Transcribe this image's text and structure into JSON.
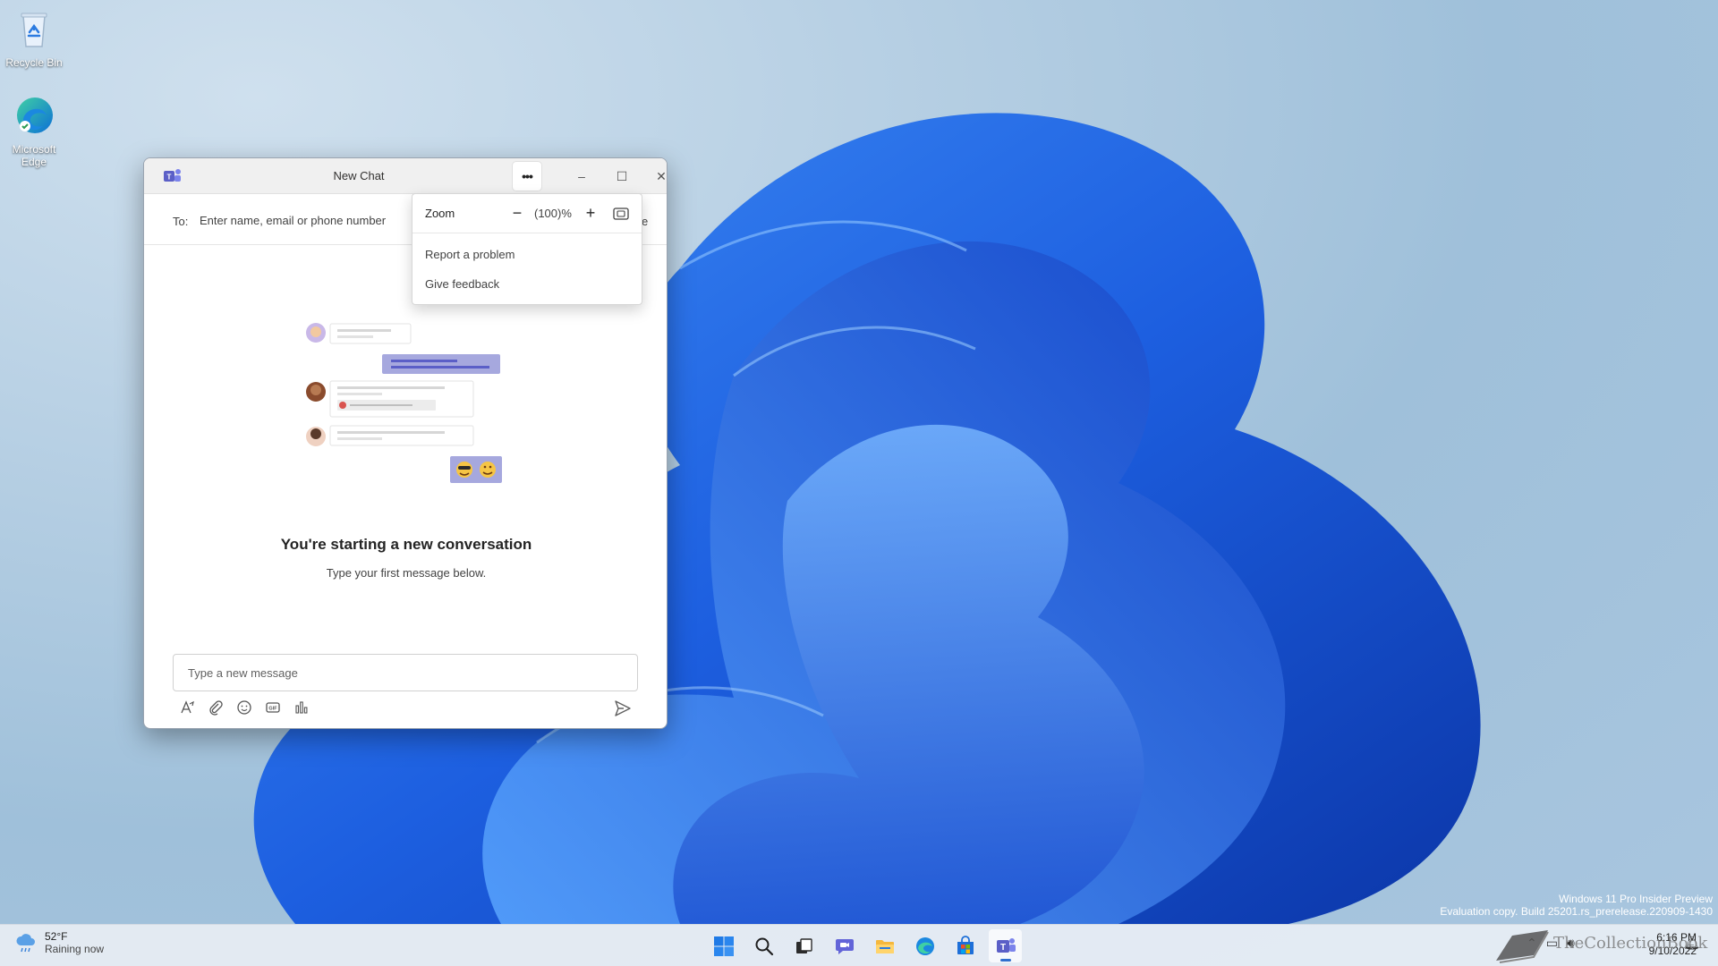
{
  "desktop": {
    "icons": [
      {
        "label": "Recycle Bin"
      },
      {
        "label": "Microsoft Edge"
      }
    ],
    "watermark": {
      "line1": "Windows 11 Pro Insider Preview",
      "line2": "Evaluation copy. Build 25201.rs_prerelease.220909-1430"
    },
    "brand": "TheCollectionBook"
  },
  "window": {
    "title": "New Chat",
    "more_label": "•••",
    "controls": {
      "minimize": "–",
      "maximize": "☐",
      "close": "✕"
    },
    "to_label": "To:",
    "to_placeholder": "Enter name, email or phone number",
    "to_trail": "e",
    "heading": "You're starting a new conversation",
    "subtext": "Type your first message below.",
    "compose_placeholder": "Type a new message"
  },
  "menu": {
    "zoom_label": "Zoom",
    "zoom_minus": "−",
    "zoom_value": "(100)%",
    "zoom_plus": "+",
    "items": [
      {
        "label": "Report a problem"
      },
      {
        "label": "Give feedback"
      }
    ]
  },
  "taskbar": {
    "weather": {
      "temp": "52°F",
      "condition": "Raining now"
    },
    "clock": {
      "time": "6:16 PM",
      "date": "9/10/2022"
    }
  },
  "colors": {
    "teams_purple": "#5b5fc7",
    "bloom_blue": "#1a63e0",
    "accent": "#2f6fcf"
  }
}
